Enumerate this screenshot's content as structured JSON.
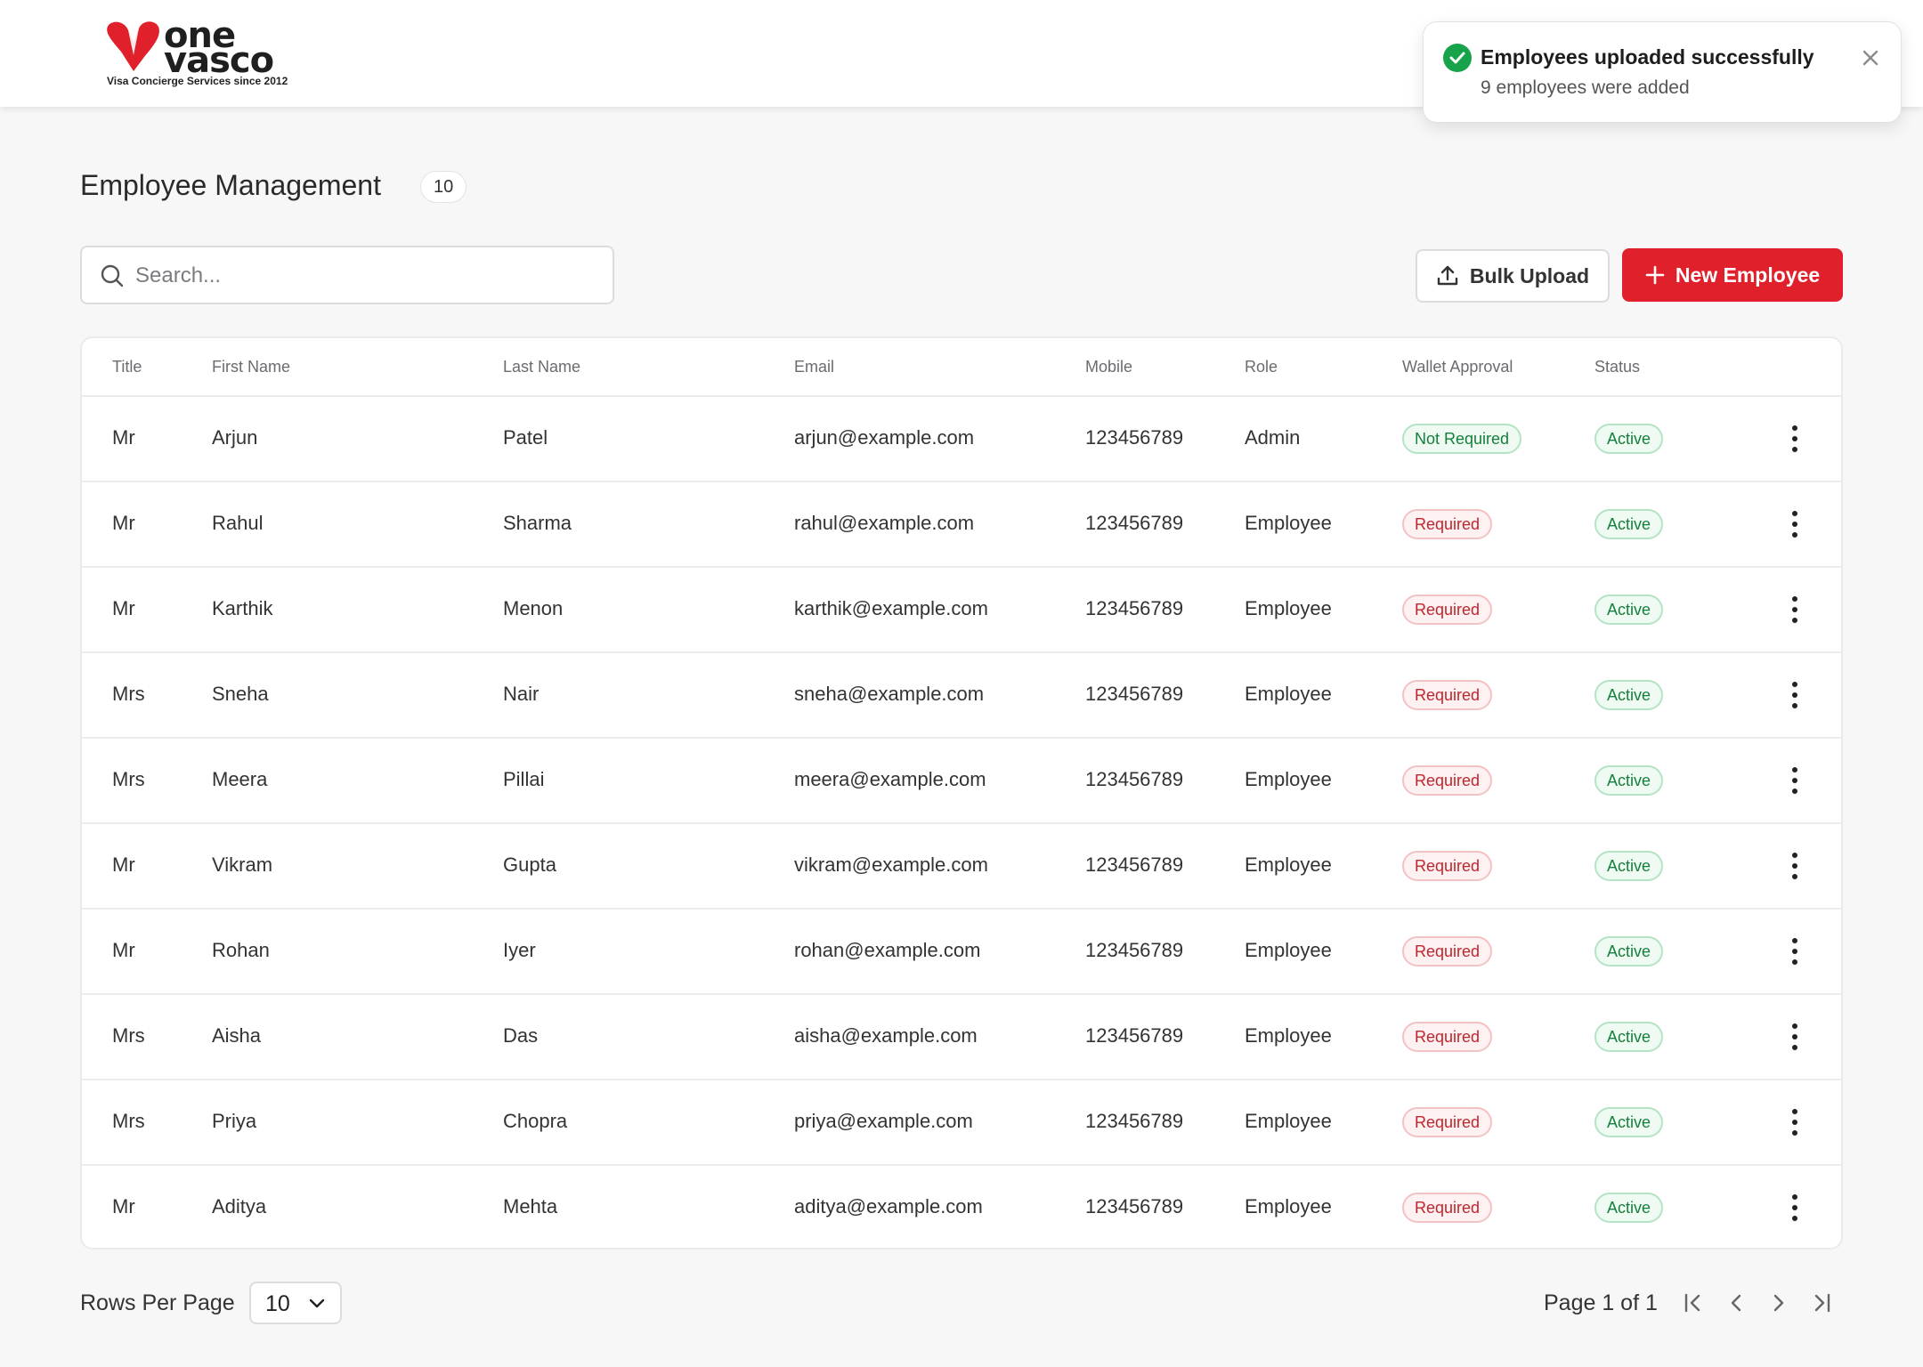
{
  "brand": {
    "word_top": "one",
    "word_bottom": "vasco",
    "tagline": "Visa Concierge Services since 2012",
    "accent_color": "#e0202a"
  },
  "toast": {
    "title": "Employees uploaded successfully",
    "message": "9 employees were added",
    "icon": "check-circle-icon",
    "close_icon": "close-icon"
  },
  "page": {
    "title": "Employee Management",
    "count": "10"
  },
  "search": {
    "placeholder": "Search..."
  },
  "actions": {
    "bulk_upload": "Bulk Upload",
    "new_employee": "New Employee"
  },
  "table": {
    "headers": {
      "title": "Title",
      "first_name": "First Name",
      "last_name": "Last Name",
      "email": "Email",
      "mobile": "Mobile",
      "role": "Role",
      "wallet": "Wallet Approval",
      "status": "Status"
    },
    "rows": [
      {
        "title": "Mr",
        "first": "Arjun",
        "last": "Patel",
        "email": "arjun@example.com",
        "mobile": "123456789",
        "role": "Admin",
        "wallet": "Not Required",
        "wallet_ok": true,
        "status": "Active"
      },
      {
        "title": "Mr",
        "first": "Rahul",
        "last": "Sharma",
        "email": "rahul@example.com",
        "mobile": "123456789",
        "role": "Employee",
        "wallet": "Required",
        "wallet_ok": false,
        "status": "Active"
      },
      {
        "title": "Mr",
        "first": "Karthik",
        "last": "Menon",
        "email": "karthik@example.com",
        "mobile": "123456789",
        "role": "Employee",
        "wallet": "Required",
        "wallet_ok": false,
        "status": "Active"
      },
      {
        "title": "Mrs",
        "first": "Sneha",
        "last": "Nair",
        "email": "sneha@example.com",
        "mobile": "123456789",
        "role": "Employee",
        "wallet": "Required",
        "wallet_ok": false,
        "status": "Active"
      },
      {
        "title": "Mrs",
        "first": "Meera",
        "last": "Pillai",
        "email": "meera@example.com",
        "mobile": "123456789",
        "role": "Employee",
        "wallet": "Required",
        "wallet_ok": false,
        "status": "Active"
      },
      {
        "title": "Mr",
        "first": "Vikram",
        "last": "Gupta",
        "email": "vikram@example.com",
        "mobile": "123456789",
        "role": "Employee",
        "wallet": "Required",
        "wallet_ok": false,
        "status": "Active"
      },
      {
        "title": "Mr",
        "first": "Rohan",
        "last": "Iyer",
        "email": "rohan@example.com",
        "mobile": "123456789",
        "role": "Employee",
        "wallet": "Required",
        "wallet_ok": false,
        "status": "Active"
      },
      {
        "title": "Mrs",
        "first": "Aisha",
        "last": "Das",
        "email": "aisha@example.com",
        "mobile": "123456789",
        "role": "Employee",
        "wallet": "Required",
        "wallet_ok": false,
        "status": "Active"
      },
      {
        "title": "Mrs",
        "first": "Priya",
        "last": "Chopra",
        "email": "priya@example.com",
        "mobile": "123456789",
        "role": "Employee",
        "wallet": "Required",
        "wallet_ok": false,
        "status": "Active"
      },
      {
        "title": "Mr",
        "first": "Aditya",
        "last": "Mehta",
        "email": "aditya@example.com",
        "mobile": "123456789",
        "role": "Employee",
        "wallet": "Required",
        "wallet_ok": false,
        "status": "Active"
      }
    ]
  },
  "pagination": {
    "rows_per_page_label": "Rows Per Page",
    "rows_per_page_value": "10",
    "page_info": "Page 1 of 1"
  }
}
